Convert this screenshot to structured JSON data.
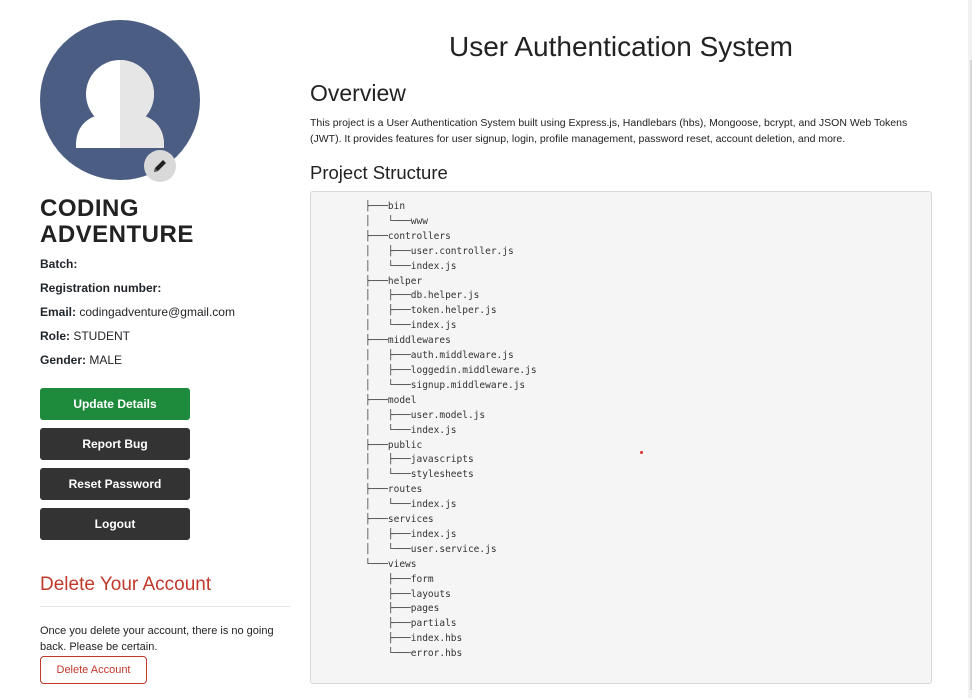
{
  "profile": {
    "name": "CODING ADVENTURE",
    "batch_label": "Batch:",
    "batch_value": "",
    "registration_label": "Registration number:",
    "registration_value": "",
    "email_label": "Email:",
    "email_value": "codingadventure@gmail.com",
    "role_label": "Role:",
    "role_value": "STUDENT",
    "gender_label": "Gender:",
    "gender_value": "MALE",
    "avatar_icon": "user-silhouette-icon",
    "edit_icon": "pencil-icon"
  },
  "actions": {
    "update_details": "Update Details",
    "report_bug": "Report Bug",
    "reset_password": "Reset Password",
    "logout": "Logout"
  },
  "danger": {
    "title": "Delete Your Account",
    "text": "Once you delete your account, there is no going back. Please be certain.",
    "button": "Delete Account"
  },
  "main": {
    "title": "User Authentication System",
    "overview_title": "Overview",
    "overview_text": "This project is a User Authentication System built using Express.js, Handlebars (hbs), Mongoose, bcrypt, and JSON Web Tokens (JWT). It provides features for user signup, login, profile management, password reset, account deletion, and more.",
    "structure_title": "Project Structure",
    "structure_tree": "├───bin\n│   └───www\n├───controllers\n│   ├───user.controller.js\n│   └───index.js\n├───helper\n│   ├───db.helper.js\n│   ├───token.helper.js\n│   └───index.js\n├───middlewares\n│   ├───auth.middleware.js\n│   ├───loggedin.middleware.js\n│   └───signup.middleware.js\n├───model\n│   ├───user.model.js\n│   └───index.js\n├───public\n│   ├───javascripts\n│   └───stylesheets\n├───routes\n│   └───index.js\n├───services\n│   ├───index.js\n│   └───user.service.js\n└───views\n    ├───form\n    ├───layouts\n    ├───pages\n    ├───partials\n    ├───index.hbs\n    └───error.hbs"
  },
  "colors": {
    "avatar_bg": "#4b5d82",
    "update_button": "#1e8a3c",
    "dark_button": "#333333",
    "danger": "#c0392b"
  }
}
